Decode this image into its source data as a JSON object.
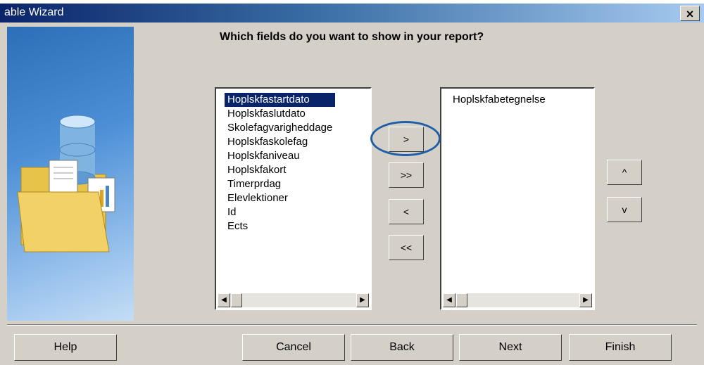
{
  "window": {
    "title": "able Wizard",
    "close_label": "×"
  },
  "main": {
    "question": "Which fields do you want to show in your report?"
  },
  "available_fields": {
    "items": [
      "Hoplskfastartdato",
      "Hoplskfaslutdato",
      "Skolefagvarigheddage",
      "Hoplskfaskolefag",
      "Hoplskfaniveau",
      "Hoplskfakort",
      "Timerprdag",
      "Elevlektioner",
      "Id",
      "Ects"
    ],
    "selected_index": 0
  },
  "selected_fields": {
    "items": [
      "Hoplskfabetegnelse"
    ]
  },
  "move_buttons": {
    "add_one": ">",
    "add_all": ">>",
    "remove_one": "<",
    "remove_all": "<<"
  },
  "order_buttons": {
    "up": "^",
    "down": "v"
  },
  "footer": {
    "help": "Help",
    "cancel": "Cancel",
    "back": "Back",
    "next": "Next",
    "finish": "Finish"
  },
  "colors": {
    "selection": "#0a246a",
    "highlight_circle": "#1f5fa8",
    "dialog_bg": "#d4d0c8"
  }
}
